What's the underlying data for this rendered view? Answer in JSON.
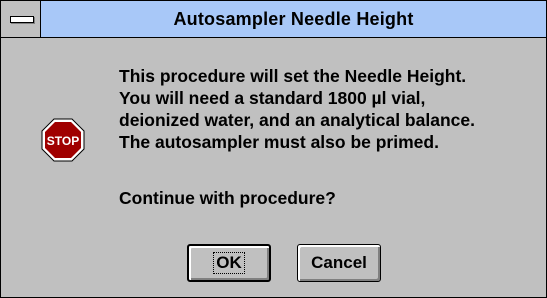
{
  "window": {
    "title": "Autosampler Needle Height"
  },
  "message": {
    "lines": [
      "This procedure will set the Needle Height.",
      "You will need a standard 1800 µl vial,",
      "deionized water, and an analytical balance.",
      "The autosampler must also be primed."
    ],
    "question": "Continue with procedure?"
  },
  "icon": {
    "name": "stop-icon",
    "label": "STOP",
    "color": "#a00000"
  },
  "buttons": {
    "ok_label": "OK",
    "cancel_label": "Cancel"
  }
}
